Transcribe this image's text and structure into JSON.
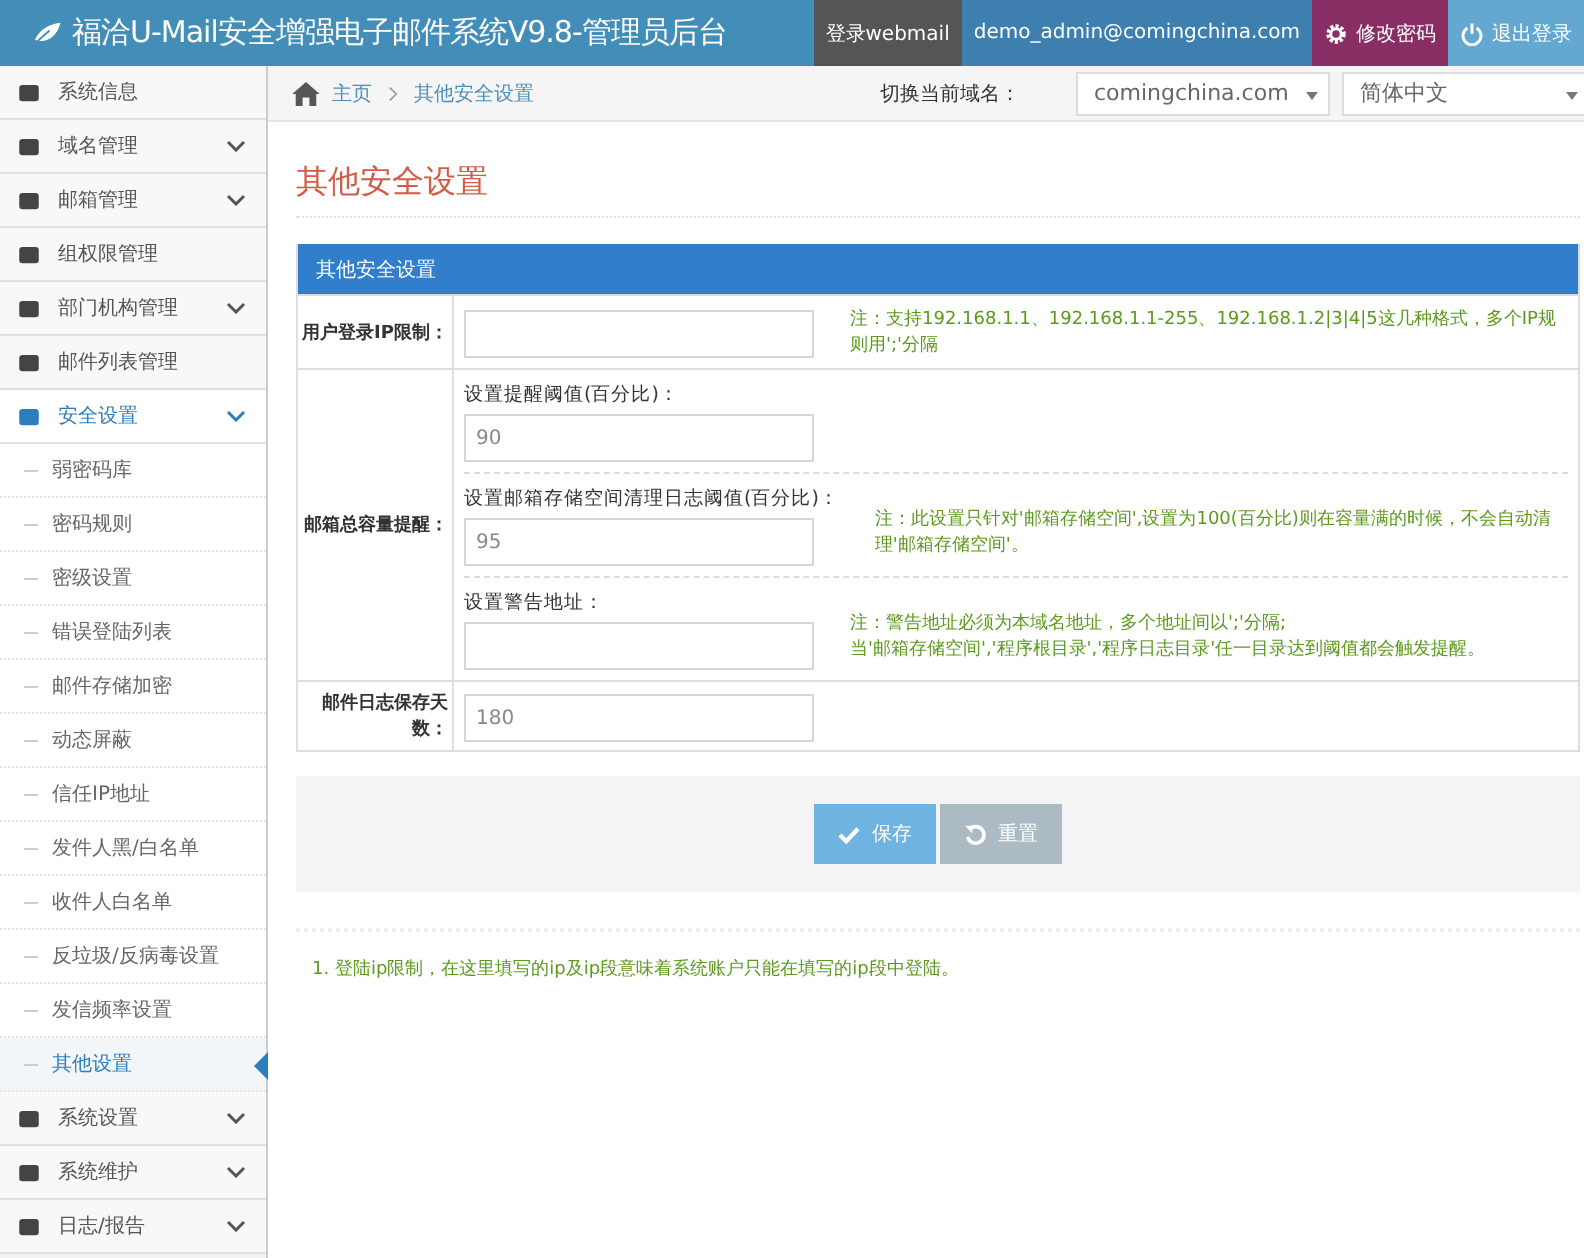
{
  "header": {
    "title": "福洽U-Mail安全增强电子邮件系统V9.8-管理员后台",
    "links": [
      {
        "label": "登录webmail",
        "kind": "webmail"
      },
      {
        "label": "demo_admin@comingchina.com",
        "kind": "user"
      },
      {
        "label": "修改密码",
        "kind": "password"
      },
      {
        "label": "退出登录",
        "kind": "logout"
      }
    ]
  },
  "sidebar": {
    "items": [
      {
        "label": "系统信息",
        "expandable": false,
        "selected": false
      },
      {
        "label": "域名管理",
        "expandable": true,
        "selected": false
      },
      {
        "label": "邮箱管理",
        "expandable": true,
        "selected": false
      },
      {
        "label": "组权限管理",
        "expandable": false,
        "selected": false
      },
      {
        "label": "部门机构管理",
        "expandable": true,
        "selected": false
      },
      {
        "label": "邮件列表管理",
        "expandable": false,
        "selected": false
      },
      {
        "label": "安全设置",
        "expandable": true,
        "selected": true,
        "expanded": true,
        "children": [
          {
            "label": "弱密码库",
            "selected": false
          },
          {
            "label": "密码规则",
            "selected": false
          },
          {
            "label": "密级设置",
            "selected": false
          },
          {
            "label": "错误登陆列表",
            "selected": false
          },
          {
            "label": "邮件存储加密",
            "selected": false
          },
          {
            "label": "动态屏蔽",
            "selected": false
          },
          {
            "label": "信任IP地址",
            "selected": false
          },
          {
            "label": "发件人黑/白名单",
            "selected": false
          },
          {
            "label": "收件人白名单",
            "selected": false
          },
          {
            "label": "反垃圾/反病毒设置",
            "selected": false
          },
          {
            "label": "发信频率设置",
            "selected": false
          },
          {
            "label": "其他设置",
            "selected": true
          }
        ]
      },
      {
        "label": "系统设置",
        "expandable": true,
        "selected": false
      },
      {
        "label": "系统维护",
        "expandable": true,
        "selected": false
      },
      {
        "label": "日志/报告",
        "expandable": true,
        "selected": false
      }
    ]
  },
  "breadcrumb": [
    "主页",
    "其他安全设置"
  ],
  "domain_switch": {
    "label": "切换当前域名：",
    "domain": "comingchina.com",
    "language": "简体中文"
  },
  "page_title": "其他安全设置",
  "panel": {
    "title": "其他安全设置",
    "rows": [
      {
        "kind": "single",
        "label": "用户登录IP限制：",
        "note": "注：支持192.168.1.1、192.168.1.1-255、192.168.1.2|3|4|5这几种格式，多个IP规则用';'分隔"
      },
      {
        "kind": "group",
        "label": "邮箱总容量提醒：",
        "fields": [
          {
            "label": "设置提醒阈值(百分比)：",
            "value": "90"
          },
          {
            "label": "设置邮箱存储空间清理日志阈值(百分比)：",
            "value": "95",
            "note": "注：此设置只针对'邮箱存储空间',设置为100(百分比)则在容量满的时候，不会自动清理'邮箱存储空间'。"
          },
          {
            "label": "设置警告地址：",
            "note": "注：警告地址必须为本域名地址，多个地址间以';'分隔;\n当'邮箱存储空间','程序根目录','程序日志目录'任一目录达到阈值都会触发提醒。"
          }
        ]
      },
      {
        "kind": "single",
        "label": "邮件日志保存天数：",
        "value": "180"
      }
    ]
  },
  "buttons": [
    {
      "label": "保存",
      "kind": "save"
    },
    {
      "label": "重置",
      "kind": "reset"
    }
  ],
  "footnote": "1. 登陆ip限制，在这里填写的ip及ip段意味着系统账户只能在填写的ip段中登陆。"
}
